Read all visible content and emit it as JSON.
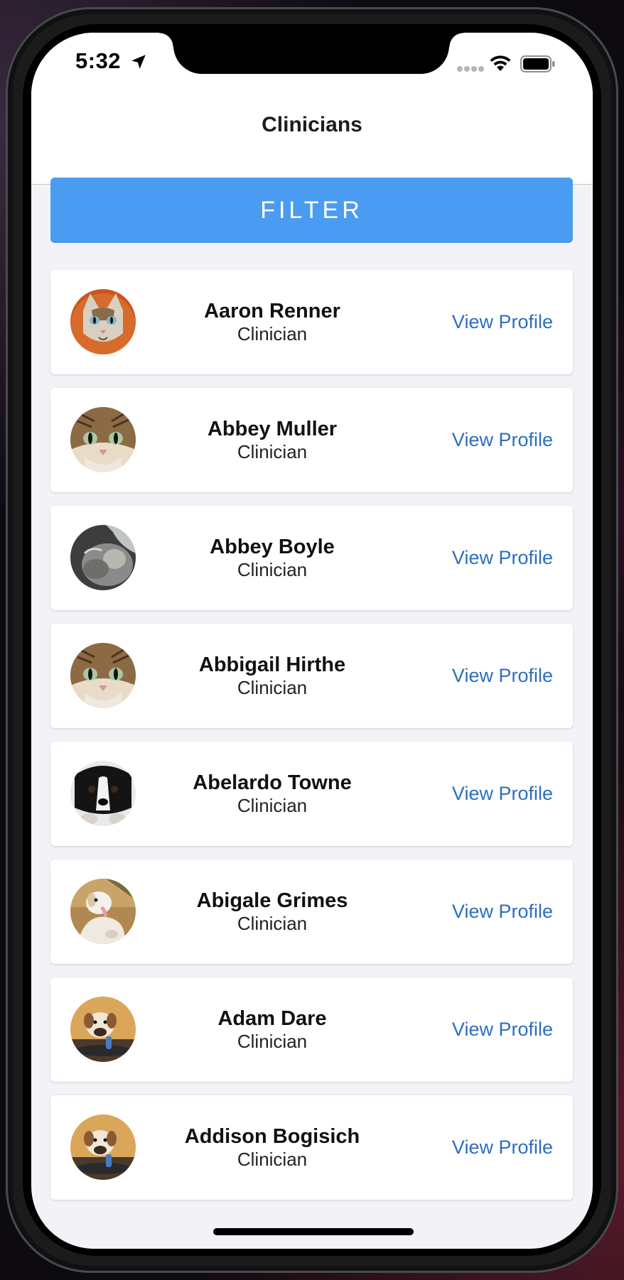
{
  "status_bar": {
    "time": "5:32",
    "icons": [
      "location-arrow-icon",
      "signal-icon",
      "wifi-icon",
      "battery-icon"
    ]
  },
  "nav": {
    "title": "Clinicians"
  },
  "filter_button": {
    "label": "FILTER",
    "color": "#4a9cf2"
  },
  "link_color": "#2d6ec0",
  "clinicians": [
    {
      "name": "Aaron Renner",
      "role": "Clinician",
      "action": "View Profile",
      "avatar": "tabby-cat-orange"
    },
    {
      "name": "Abbey Muller",
      "role": "Clinician",
      "action": "View Profile",
      "avatar": "tabby-cat-closeup"
    },
    {
      "name": "Abbey Boyle",
      "role": "Clinician",
      "action": "View Profile",
      "avatar": "gray-cat"
    },
    {
      "name": "Abbigail Hirthe",
      "role": "Clinician",
      "action": "View Profile",
      "avatar": "tabby-cat-closeup"
    },
    {
      "name": "Abelardo Towne",
      "role": "Clinician",
      "action": "View Profile",
      "avatar": "black-puppy"
    },
    {
      "name": "Abigale Grimes",
      "role": "Clinician",
      "action": "View Profile",
      "avatar": "white-dog"
    },
    {
      "name": "Adam Dare",
      "role": "Clinician",
      "action": "View Profile",
      "avatar": "bulldog-puppy"
    },
    {
      "name": "Addison Bogisich",
      "role": "Clinician",
      "action": "View Profile",
      "avatar": "bulldog-puppy"
    }
  ]
}
